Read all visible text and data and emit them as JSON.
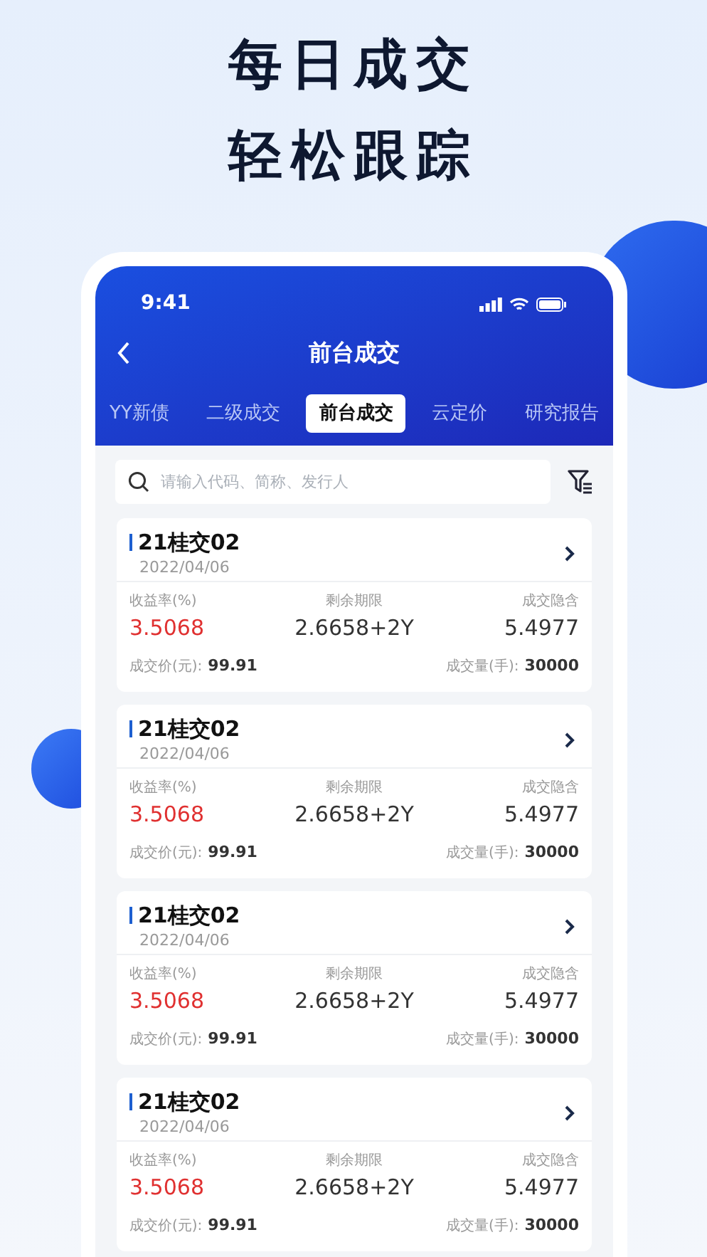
{
  "headline": [
    "每日成交",
    "轻松跟踪"
  ],
  "status_bar": {
    "time": "9:41"
  },
  "nav": {
    "title": "前台成交"
  },
  "tabs": [
    {
      "label": "YY新债",
      "selected": false
    },
    {
      "label": "二级成交",
      "selected": false
    },
    {
      "label": "前台成交",
      "selected": true
    },
    {
      "label": "云定价",
      "selected": false
    },
    {
      "label": "研究报告",
      "selected": false
    }
  ],
  "search": {
    "placeholder": "请输入代码、简称、发行人"
  },
  "cards": [
    {
      "title": "21桂交02",
      "date": "2022/04/06",
      "yield_label": "收益率(%)",
      "yield": "3.5068",
      "term_label": "剩余期限",
      "term": "2.6658+2Y",
      "implied_label": "成交隐含",
      "implied": "5.4977",
      "price_label": "成交价(元):",
      "price": "99.91",
      "volume_label": "成交量(手):",
      "volume": "30000"
    },
    {
      "title": "21桂交02",
      "date": "2022/04/06",
      "yield_label": "收益率(%)",
      "yield": "3.5068",
      "term_label": "剩余期限",
      "term": "2.6658+2Y",
      "implied_label": "成交隐含",
      "implied": "5.4977",
      "price_label": "成交价(元):",
      "price": "99.91",
      "volume_label": "成交量(手):",
      "volume": "30000"
    },
    {
      "title": "21桂交02",
      "date": "2022/04/06",
      "yield_label": "收益率(%)",
      "yield": "3.5068",
      "term_label": "剩余期限",
      "term": "2.6658+2Y",
      "implied_label": "成交隐含",
      "implied": "5.4977",
      "price_label": "成交价(元):",
      "price": "99.91",
      "volume_label": "成交量(手):",
      "volume": "30000"
    },
    {
      "title": "21桂交02",
      "date": "2022/04/06",
      "yield_label": "收益率(%)",
      "yield": "3.5068",
      "term_label": "剩余期限",
      "term": "2.6658+2Y",
      "implied_label": "成交隐含",
      "implied": "5.4977",
      "price_label": "成交价(元):",
      "price": "99.91",
      "volume_label": "成交量(手):",
      "volume": "30000"
    }
  ]
}
